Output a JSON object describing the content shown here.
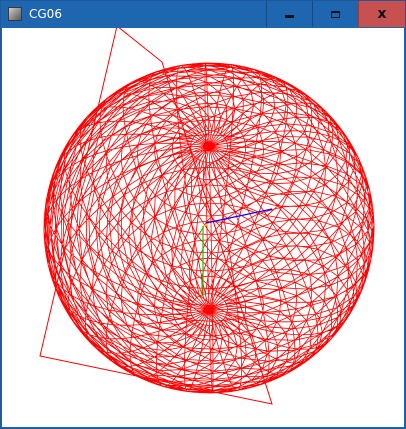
{
  "window": {
    "title": "CG06",
    "app_icon": "app-window-icon",
    "controls": {
      "minimize_icon": "minimize-icon",
      "maximize_icon": "maximize-icon",
      "close_glyph": "x",
      "close_color": "#c75050"
    },
    "titlebar_color": "#1e66b0"
  },
  "scene": {
    "background": "#ffffff",
    "sphere_color": "#ff0000",
    "sphere_latitude_bands": 28,
    "sphere_longitude_segments": 36,
    "axis_colors": {
      "x": "#0000ff",
      "y": "#00ff00",
      "z": "#ffff00"
    }
  }
}
